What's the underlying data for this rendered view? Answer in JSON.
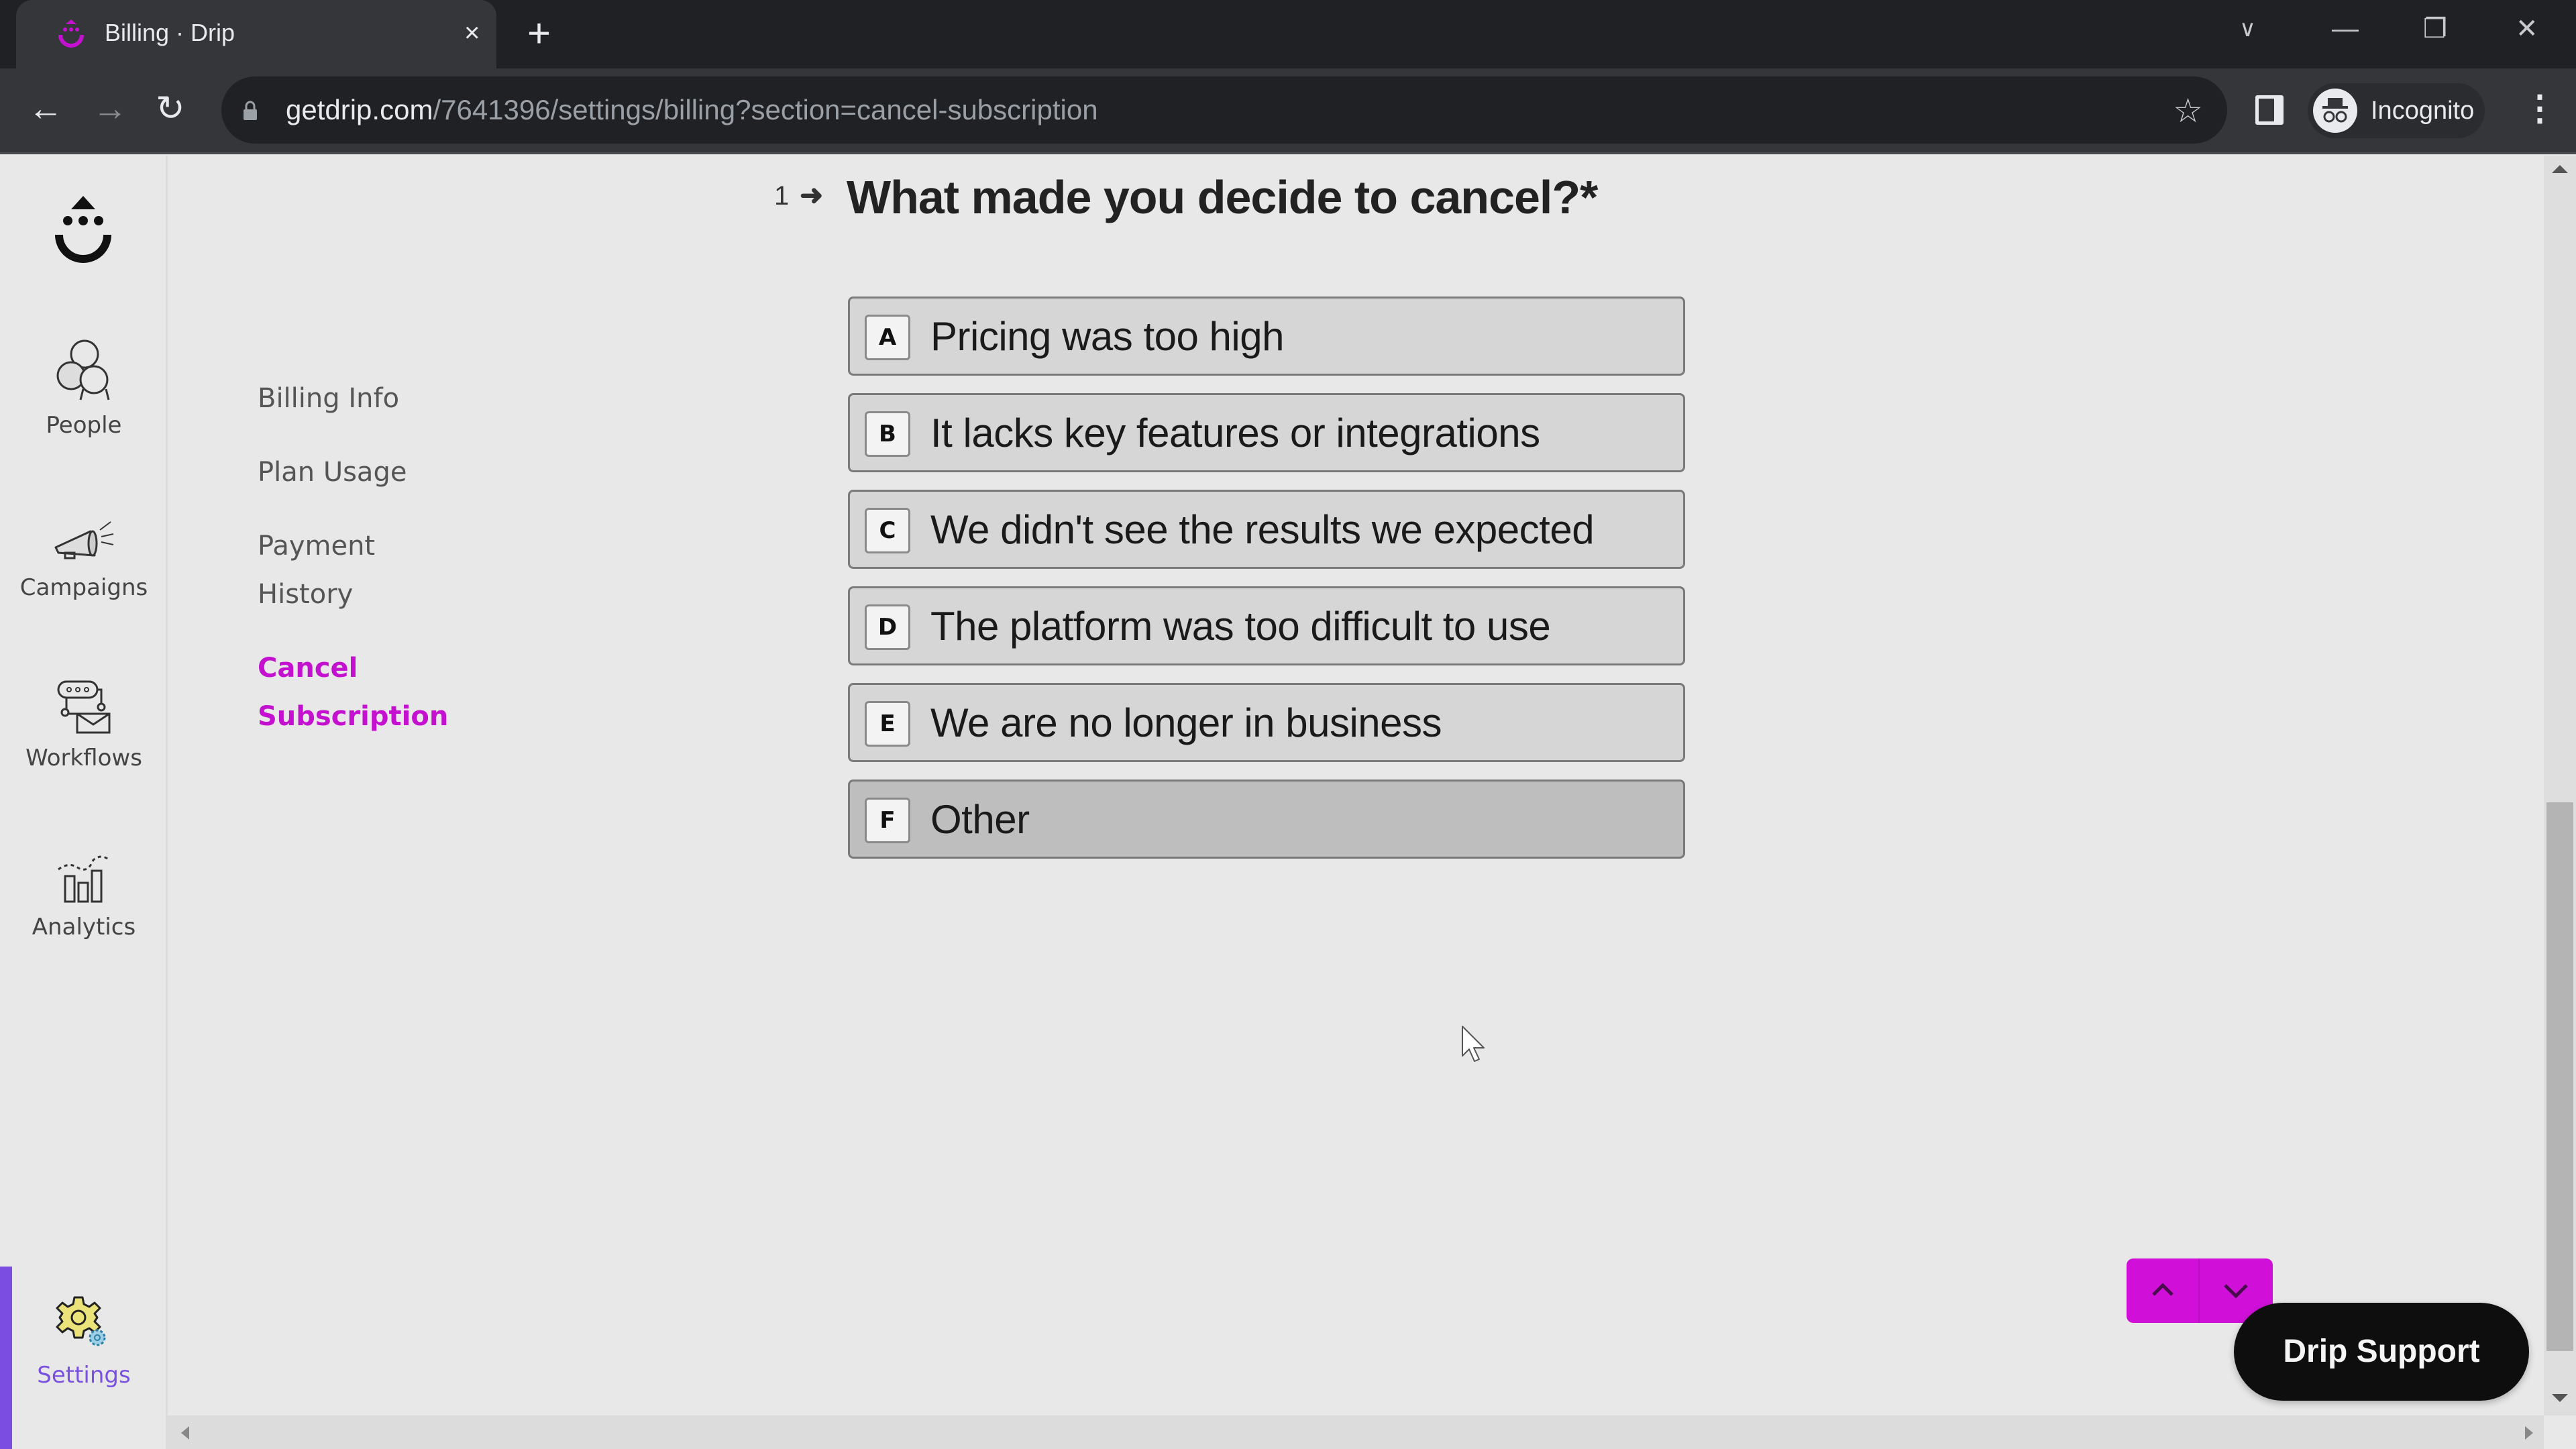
{
  "browser": {
    "tab_title": "Billing · Drip",
    "tab_close": "×",
    "new_tab": "+",
    "url_host": "getdrip.com",
    "url_path": "/7641396/settings/billing?section=cancel-subscription",
    "profile_label": "Incognito",
    "icons": {
      "back": "←",
      "forward": "→",
      "reload": "↻",
      "star": "☆",
      "menu": "⋮",
      "tab_search": "∨",
      "minimize": "—",
      "restore": "❐",
      "close": "✕"
    }
  },
  "app": {
    "brand_color": "#c411cf",
    "settings_accent": "#7b52e0",
    "leftnav": [
      {
        "id": "people",
        "label": "People",
        "icon": "people-icon"
      },
      {
        "id": "campaigns",
        "label": "Campaigns",
        "icon": "megaphone-icon"
      },
      {
        "id": "workflows",
        "label": "Workflows",
        "icon": "workflow-icon"
      },
      {
        "id": "analytics",
        "label": "Analytics",
        "icon": "analytics-icon"
      },
      {
        "id": "settings",
        "label": "Settings",
        "icon": "gear-icon",
        "active": true
      }
    ],
    "subnav": [
      {
        "label": "Billing Info"
      },
      {
        "label": "Plan Usage"
      },
      {
        "label_line1": "Payment",
        "label_line2": "History"
      },
      {
        "label_line1": "Cancel",
        "label_line2": "Subscription",
        "active": true
      }
    ]
  },
  "form": {
    "question_number": "1",
    "question_arrow": "➜",
    "question_text": "What made you decide to cancel?*",
    "choices": [
      {
        "key": "A",
        "label": "Pricing was too high"
      },
      {
        "key": "B",
        "label": "It lacks key features or integrations"
      },
      {
        "key": "C",
        "label": "We didn't see the results we expected"
      },
      {
        "key": "D",
        "label": "The platform was too difficult to use"
      },
      {
        "key": "E",
        "label": "We are no longer in business"
      },
      {
        "key": "F",
        "label": "Other",
        "hovered": true
      }
    ]
  },
  "widgets": {
    "support_label": "Drip Support"
  }
}
